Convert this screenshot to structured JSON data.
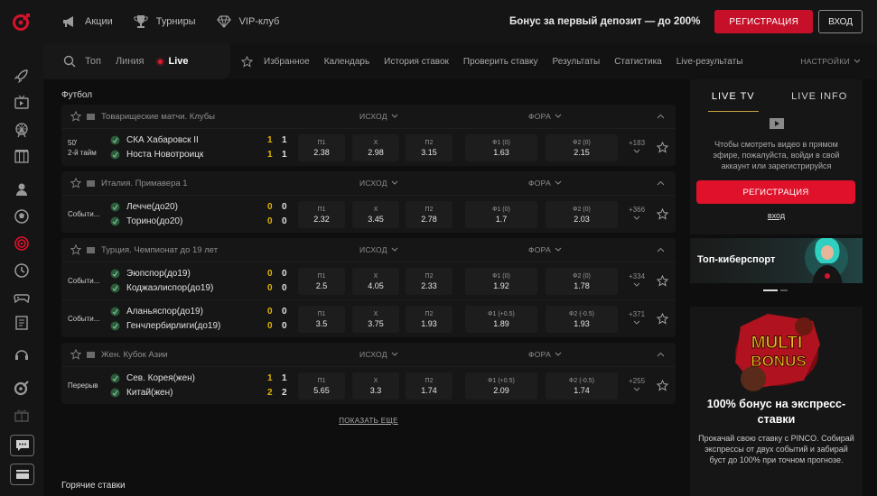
{
  "header": {
    "nav": [
      {
        "label": "Акции",
        "icon": "megaphone-icon"
      },
      {
        "label": "Турниры",
        "icon": "trophy-icon"
      },
      {
        "label": "VIP-клуб",
        "icon": "diamond-icon"
      }
    ],
    "bonus_text": "Бонус за первый депозит — до 200%",
    "register_label": "РЕГИСТРАЦИЯ",
    "login_label": "ВХОД"
  },
  "subnav": {
    "tabs": [
      "Топ",
      "Линия"
    ],
    "live_label": "Live",
    "links": [
      "Избранное",
      "Календарь",
      "История ставок",
      "Проверить ставку",
      "Результаты",
      "Статистика",
      "Live-результаты"
    ],
    "settings_label": "НАСТРОЙКИ"
  },
  "sport_title": "Футбол",
  "columns": {
    "ishod": "ИСХОД",
    "fora": "ФОРА"
  },
  "leagues": [
    {
      "name": "Товарищеские матчи. Клубы",
      "events": [
        {
          "status1": "50'",
          "status2": "2-й тайм",
          "team1": "СКА Хабаровск II",
          "team2": "Носта Новотроицк",
          "s1a": "1",
          "s1b": "1",
          "s2a": "1",
          "s2b": "1",
          "odds": [
            {
              "l": "П1",
              "v": "2.38"
            },
            {
              "l": "Х",
              "v": "2.98"
            },
            {
              "l": "П2",
              "v": "3.15"
            },
            {
              "l": "Ф1 (0)",
              "v": "1.63"
            },
            {
              "l": "Ф2 (0)",
              "v": "2.15"
            }
          ],
          "more": "+183"
        }
      ]
    },
    {
      "name": "Италия. Примавера 1",
      "events": [
        {
          "status1": "Событи...",
          "status2": "",
          "team1": "Лечче(до20)",
          "team2": "Торино(до20)",
          "s1a": "0",
          "s1b": "0",
          "s2a": "0",
          "s2b": "0",
          "odds": [
            {
              "l": "П1",
              "v": "2.32"
            },
            {
              "l": "Х",
              "v": "3.45"
            },
            {
              "l": "П2",
              "v": "2.78"
            },
            {
              "l": "Ф1 (0)",
              "v": "1.7"
            },
            {
              "l": "Ф2 (0)",
              "v": "2.03"
            }
          ],
          "more": "+366"
        }
      ]
    },
    {
      "name": "Турция. Чемпионат до 19 лет",
      "events": [
        {
          "status1": "Событи...",
          "status2": "",
          "team1": "Эюпспор(до19)",
          "team2": "Коджаэлиспор(до19)",
          "s1a": "0",
          "s1b": "0",
          "s2a": "0",
          "s2b": "0",
          "odds": [
            {
              "l": "П1",
              "v": "2.5"
            },
            {
              "l": "Х",
              "v": "4.05"
            },
            {
              "l": "П2",
              "v": "2.33"
            },
            {
              "l": "Ф1 (0)",
              "v": "1.92"
            },
            {
              "l": "Ф2 (0)",
              "v": "1.78"
            }
          ],
          "more": "+334"
        },
        {
          "status1": "Событи...",
          "status2": "",
          "team1": "Аланьяспор(до19)",
          "team2": "Генчлербирлиги(до19)",
          "s1a": "0",
          "s1b": "0",
          "s2a": "0",
          "s2b": "0",
          "odds": [
            {
              "l": "П1",
              "v": "3.5"
            },
            {
              "l": "Х",
              "v": "3.75"
            },
            {
              "l": "П2",
              "v": "1.93"
            },
            {
              "l": "Ф1 (+0.5)",
              "v": "1.89"
            },
            {
              "l": "Ф2 (-0.5)",
              "v": "1.93"
            }
          ],
          "more": "+371"
        }
      ]
    },
    {
      "name": "Жен. Кубок Азии",
      "events": [
        {
          "status1": "Перерыв",
          "status2": "",
          "team1": "Сев. Корея(жен)",
          "team2": "Китай(жен)",
          "s1a": "1",
          "s1b": "1",
          "s2a": "2",
          "s2b": "2",
          "odds": [
            {
              "l": "П1",
              "v": "5.65"
            },
            {
              "l": "Х",
              "v": "3.3"
            },
            {
              "l": "П2",
              "v": "1.74"
            },
            {
              "l": "Ф1 (+0.5)",
              "v": "2.09"
            },
            {
              "l": "Ф2 (-0.5)",
              "v": "1.74"
            }
          ],
          "more": "+255"
        }
      ]
    }
  ],
  "show_more": "ПОКАЗАТЬ ЕЩЕ",
  "hot_bets": "Горячие ставки",
  "tv": {
    "tab_tv": "LIVE TV",
    "tab_info": "LIVE INFO",
    "text": "Чтобы смотреть видео в прямом эфире, пожалуйста, войди в свой аккаунт или зарегистрируйся",
    "register": "РЕГИСТРАЦИЯ",
    "login": "вход"
  },
  "esport_title": "Топ-киберспорт",
  "promo": {
    "logo_text": "MULTI BONUS",
    "title": "100% бонус на экспресс-ставки",
    "text": "Прокачай свою ставку с PINCO. Собирай экспрессы от двух событий и забирай буст до 100% при точном прогнозе."
  },
  "colors": {
    "accent": "#c6102a",
    "score": "#e1b400",
    "gold": "#c9a545"
  }
}
